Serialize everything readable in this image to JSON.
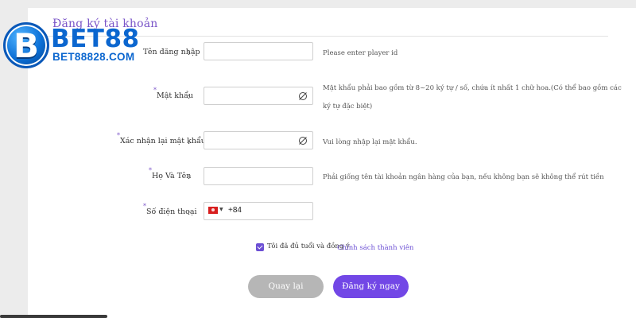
{
  "form": {
    "title": "Đăng ký tài khoản",
    "username": {
      "label": "Tên đăng nhập",
      "hint": "Please enter player id",
      "value": ""
    },
    "password": {
      "label": "Mật khẩu",
      "hint_line1": "Mật khẩu phải bao gồm từ 8~20 ký tự / số, chứa ít nhất 1 chữ hoa.(Có thể bao gồm các",
      "hint_line2": "ký tự đặc biệt)",
      "value": ""
    },
    "confirm_password": {
      "label": "Xác nhận lại mật khẩu",
      "hint": "Vui lòng nhập lại mật khẩu.",
      "value": ""
    },
    "full_name": {
      "label": "Họ Và Tên",
      "hint": "Phải giống tên tài khoản ngân hàng của bạn, nếu không bạn sẽ không thể rút tiền",
      "value": ""
    },
    "phone": {
      "label": "Số điện thoại",
      "dial_code": "+84",
      "value": ""
    },
    "colon": ":",
    "required_mark": "*",
    "agree_text": "Tôi đã đủ tuổi và đồng ý",
    "agree_link": "Chính sách thành viên",
    "agree_checked": true,
    "back_label": "Quay lại",
    "submit_label": "Đăng ký ngay"
  },
  "logo": {
    "letter": "B",
    "name": "BET88",
    "site": "BET88828.COM"
  },
  "colors": {
    "accent": "#7247e6",
    "logo_blue": "#0b66cf",
    "back_button": "#b6b6b6"
  },
  "icons": {
    "password_toggle": "eye-off-icon",
    "flag": "vietnam-flag-icon"
  }
}
